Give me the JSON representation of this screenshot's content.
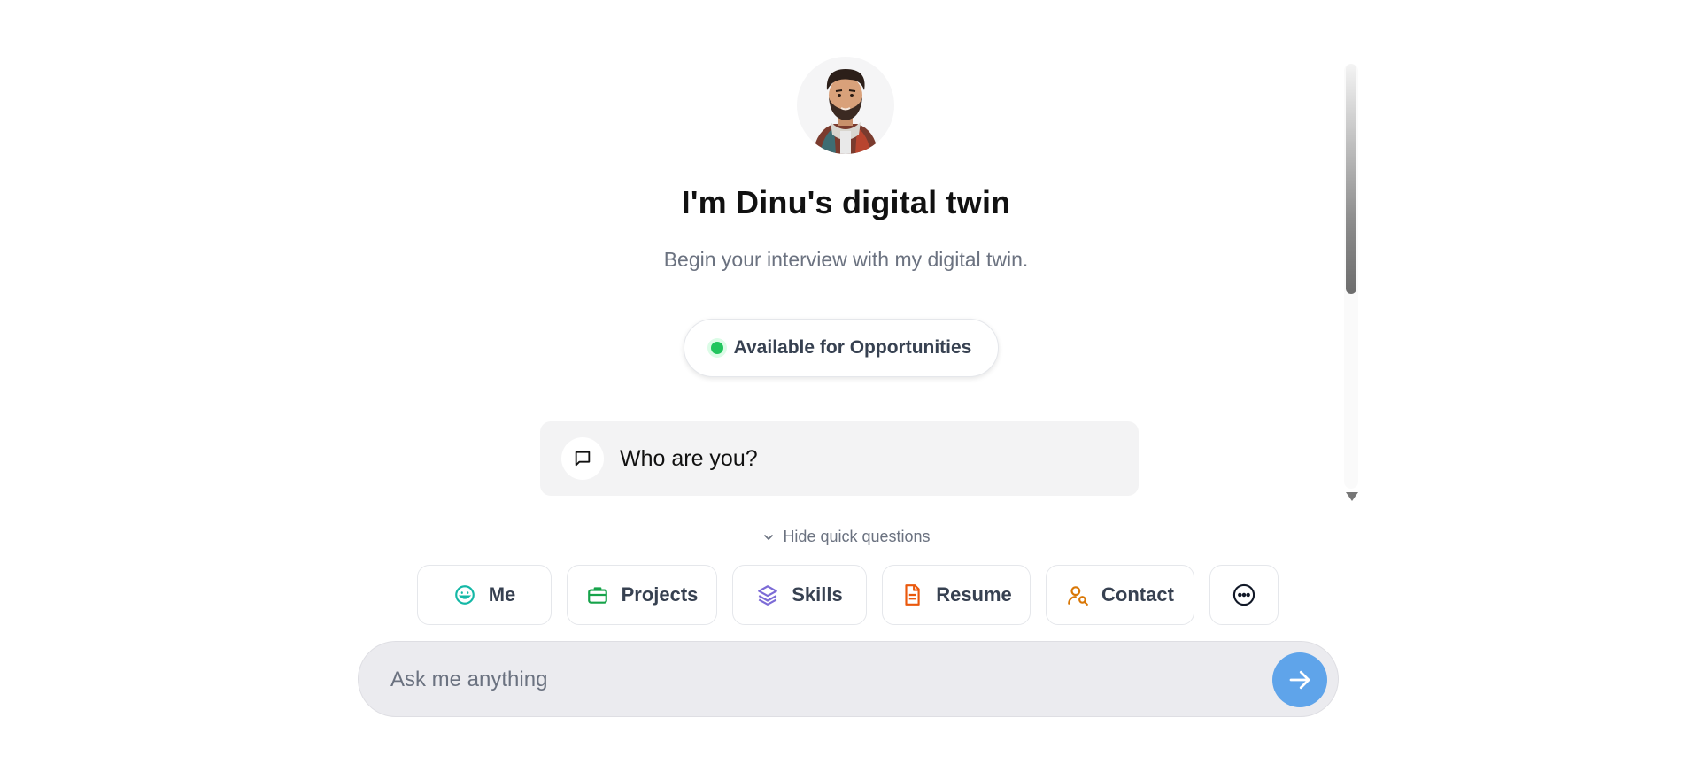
{
  "hero": {
    "avatar_icon": "profile-avatar",
    "title": "I'm Dinu's digital twin",
    "subtitle": "Begin your interview with my digital twin."
  },
  "status": {
    "label": "Available for Opportunities",
    "color": "#22c55e"
  },
  "chat": {
    "messages": [
      {
        "role": "user",
        "icon": "message-square-icon",
        "text": "Who are you?"
      }
    ]
  },
  "quick_questions": {
    "toggle_label": "Hide quick questions",
    "toggle_icon": "chevron-down-icon",
    "items": [
      {
        "label": "Me",
        "icon": "smile-icon",
        "color": "#14b8a6"
      },
      {
        "label": "Projects",
        "icon": "briefcase-icon",
        "color": "#16a34a"
      },
      {
        "label": "Skills",
        "icon": "layers-icon",
        "color": "#7c6bd6"
      },
      {
        "label": "Resume",
        "icon": "file-text-icon",
        "color": "#ea580c"
      },
      {
        "label": "Contact",
        "icon": "user-search-icon",
        "color": "#d97706"
      },
      {
        "label": "",
        "icon": "more-horizontal-icon",
        "color": "#111827"
      }
    ]
  },
  "composer": {
    "placeholder": "Ask me anything",
    "send_icon": "arrow-right-icon",
    "send_color": "#5fa4ea"
  }
}
